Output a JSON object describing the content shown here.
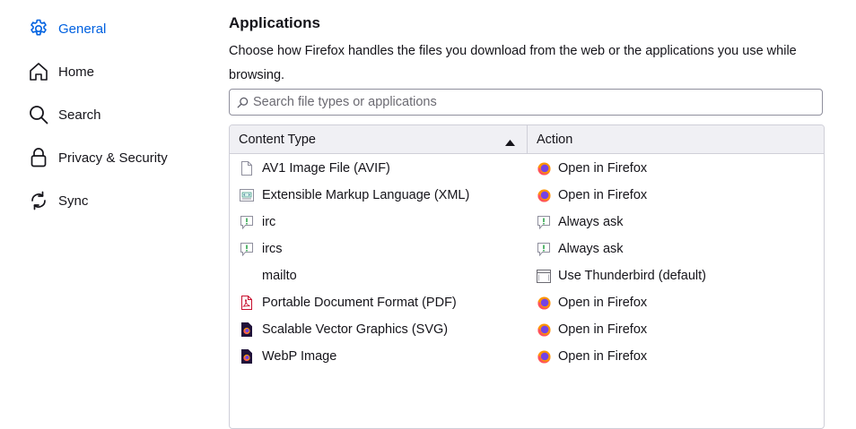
{
  "sidebar": {
    "items": [
      {
        "label": "General",
        "icon": "gear-icon"
      },
      {
        "label": "Home",
        "icon": "home-icon"
      },
      {
        "label": "Search",
        "icon": "search-icon"
      },
      {
        "label": "Privacy & Security",
        "icon": "lock-icon"
      },
      {
        "label": "Sync",
        "icon": "sync-icon"
      }
    ],
    "selected_color": "#0061e0"
  },
  "main": {
    "title": "Applications",
    "description": "Choose how Firefox handles the files you download from the web or the applications you use while browsing.",
    "search": {
      "placeholder": "Search file types or applications",
      "value": ""
    },
    "table": {
      "columns": [
        "Content Type",
        "Action"
      ],
      "sort": "ascending",
      "rows": [
        {
          "type": "AV1 Image File (AVIF)",
          "type_icon": "generic-file-icon",
          "action": "Open in Firefox",
          "action_icon": "firefox-icon"
        },
        {
          "type": "Extensible Markup Language (XML)",
          "type_icon": "xml-file-icon",
          "action": "Open in Firefox",
          "action_icon": "firefox-icon"
        },
        {
          "type": "irc",
          "type_icon": "ask-icon",
          "action": "Always ask",
          "action_icon": "ask-icon"
        },
        {
          "type": "ircs",
          "type_icon": "ask-icon",
          "action": "Always ask",
          "action_icon": "ask-icon"
        },
        {
          "type": "mailto",
          "type_icon": "",
          "action": "Use Thunderbird (default)",
          "action_icon": "application-icon"
        },
        {
          "type": "Portable Document Format (PDF)",
          "type_icon": "pdf-file-icon",
          "action": "Open in Firefox",
          "action_icon": "firefox-icon"
        },
        {
          "type": "Scalable Vector Graphics (SVG)",
          "type_icon": "firefox-doc-icon",
          "action": "Open in Firefox",
          "action_icon": "firefox-icon"
        },
        {
          "type": "WebP Image",
          "type_icon": "firefox-doc-icon",
          "action": "Open in Firefox",
          "action_icon": "firefox-icon"
        }
      ]
    }
  }
}
